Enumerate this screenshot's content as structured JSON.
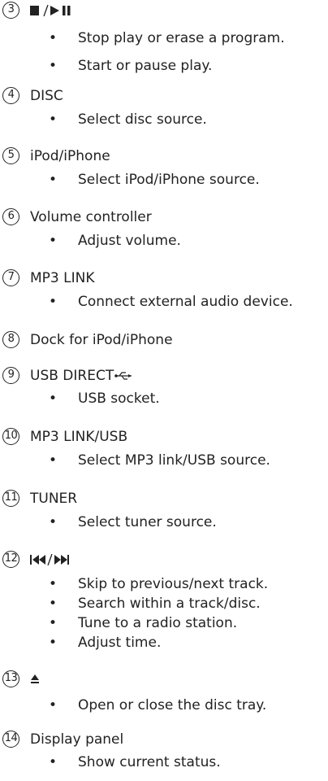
{
  "bullet_char": "•",
  "items": [
    {
      "number": "3",
      "heading": "",
      "icon": "stop-play-pause-icon",
      "bullets": [
        "Stop play or erase a program.",
        "Start or pause play."
      ]
    },
    {
      "number": "4",
      "heading": "DISC",
      "bullets": [
        "Select disc source."
      ]
    },
    {
      "number": "5",
      "heading": "iPod/iPhone",
      "bullets": [
        "Select iPod/iPhone source."
      ]
    },
    {
      "number": "6",
      "heading": "Volume controller",
      "bullets": [
        "Adjust volume."
      ]
    },
    {
      "number": "7",
      "heading": "MP3 LINK",
      "bullets": [
        "Connect external audio device."
      ]
    },
    {
      "number": "8",
      "heading": "Dock for iPod/iPhone",
      "bullets": []
    },
    {
      "number": "9",
      "heading": "USB DIRECT",
      "icon": "usb-icon",
      "bullets": [
        "USB socket."
      ]
    },
    {
      "number": "10",
      "heading": "MP3 LINK/USB",
      "bullets": [
        "Select MP3 link/USB source."
      ]
    },
    {
      "number": "11",
      "heading": "TUNER",
      "bullets": [
        "Select tuner source."
      ]
    },
    {
      "number": "12",
      "heading": "",
      "icon": "previous-next-icon",
      "bullets": [
        "Skip to previous/next track.",
        "Search within a track/disc.",
        "Tune to a radio station.",
        "Adjust time."
      ]
    },
    {
      "number": "13",
      "heading": "",
      "icon": "eject-icon",
      "bullets": [
        "Open or close the disc tray."
      ]
    },
    {
      "number": "14",
      "heading": "Display panel",
      "bullets": [
        "Show current status."
      ]
    }
  ]
}
